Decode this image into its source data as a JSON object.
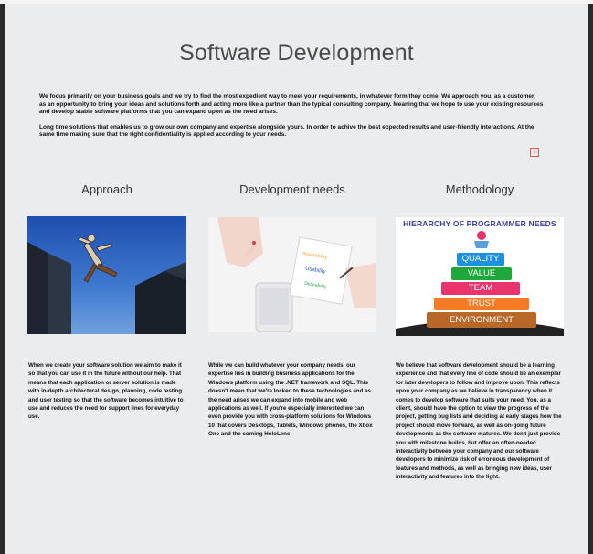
{
  "title": "Software Development",
  "intro": [
    "We focus primarily on your business goals and we try to find the most expedient way to meet your requirements, in whatever form they come. We approach you, as a customer, as an opportunity to bring your ideas and solutions forth and acting more like a partner than the typical consulting company. Meaning that we hope to use your existing resources and develop stable software platforms that you can expand upon as the need arises.",
    "Long time solutions that enables us to grow our own company and expertise alongside yours. In order to achive the best expected results and user-friendly interactions. At the same time making sure that the right confidentiality is applied according to your needs."
  ],
  "columns": [
    {
      "heading": "Approach",
      "text": "When we create your software solution we aim to make it so that you can use it in the future without our help. That means that each application or server solution is made with in-depth architectural design, planning, code testing and user testing so that the software becomes intuitive to use and reduces the need for support lines for everyday use."
    },
    {
      "heading": "Development needs",
      "text": "While we can build whatever your company needs, our expertise lies in building business applications for the Windows platform using the .NET framework and SQL. This doesn't mean that we're locked to these technologies and as the need arises we can expand into mobile and web applications as well. If you're especially interested we can even provide you with cross-platform solutions for Windows 10 that covers Desktops, Tablets, Windows phones, the Xbox One and the coming HoloLens",
      "image_words": [
        "Accessibility",
        "Usability",
        "Desirability"
      ]
    },
    {
      "heading": "Methodology",
      "text": "We believe that software development should be a learning experience and that every line of code should be an exemplar for later developers to follow and improve upon. This reflects upon your company as we believe in transparency when it comes to develop software that suits your need. You, as a client, should have the option to view the progress of the project, getting bug lists and deciding at early stages how the project should move forward, as well as on-going future developments as the software matures. We don't just provide you with milestone builds, but offer an often-needed interactivity between your company and our software developers to minimize risk of erroneous development of features and methods, as well as bringing new ideas, user interactivity and features into the light.",
      "pyramid_title": "HIERARCHY OF PROGRAMMER NEEDS",
      "pyramid": [
        {
          "label": "QUALITY",
          "color": "#1e90e0"
        },
        {
          "label": "VALUE",
          "color": "#1fa83a"
        },
        {
          "label": "TEAM",
          "color": "#e8336d"
        },
        {
          "label": "TRUST",
          "color": "#f47a26"
        },
        {
          "label": "ENVIRONMENT",
          "color": "#b9682a"
        }
      ]
    }
  ]
}
